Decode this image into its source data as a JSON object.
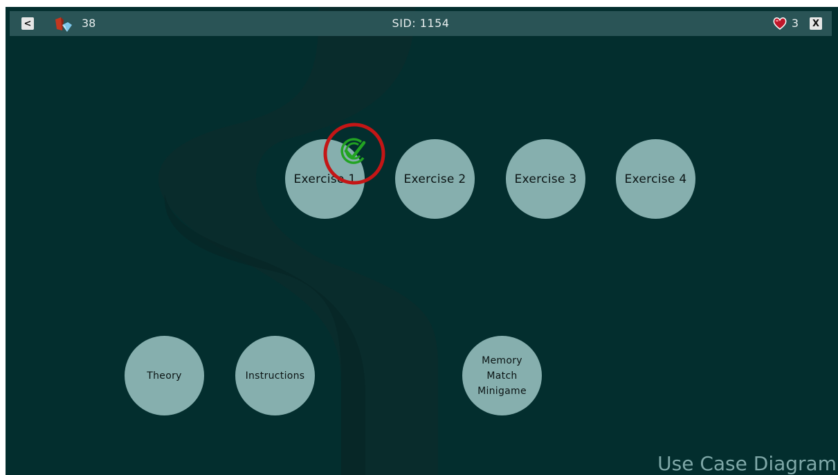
{
  "topbar": {
    "back_label": "<",
    "close_label": "X",
    "gem_count": "38",
    "sid": "SID: 1154",
    "lives": "3"
  },
  "nodes": {
    "exercise_1": "Exercise 1",
    "exercise_2": "Exercise 2",
    "exercise_3": "Exercise 3",
    "exercise_4": "Exercise 4",
    "theory": "Theory",
    "instructions": "Instructions",
    "minigame_line1": "Memory",
    "minigame_line2": "Match",
    "minigame_line3": "Minigame"
  },
  "completed": [
    "exercise_1"
  ],
  "caption": "Use Case Diagram",
  "colors": {
    "background": "#032e2e",
    "topbar": "#2a5456",
    "node_fill": "#86afae",
    "check_green": "#22a322",
    "highlight_ring": "#c41616"
  },
  "icons": {
    "gem": "gem-icon",
    "heart": "heart-icon",
    "check": "checkmark-icon"
  }
}
